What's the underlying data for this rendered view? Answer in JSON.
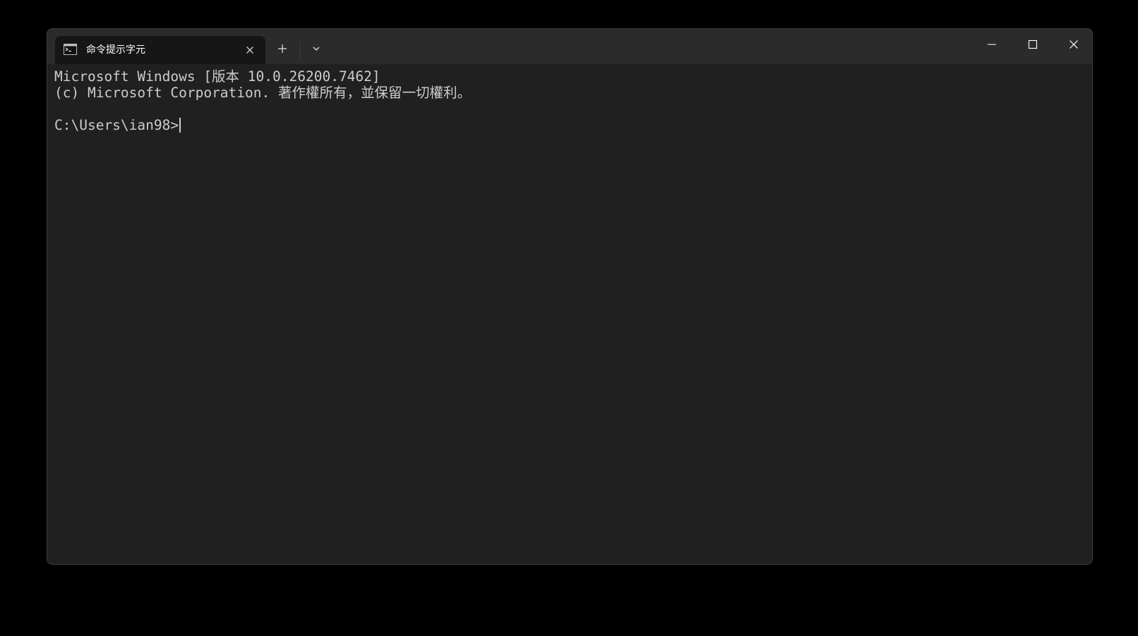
{
  "tab": {
    "title": "命令提示字元",
    "icon": "cmd-console-icon"
  },
  "tabbar": {
    "new_tab_icon": "plus-icon",
    "dropdown_icon": "chevron-down-icon"
  },
  "caption_buttons": {
    "minimize_icon": "minimize-icon",
    "maximize_icon": "maximize-icon",
    "close_icon": "close-icon"
  },
  "terminal": {
    "lines": [
      "Microsoft Windows [版本 10.0.26200.7462]",
      "(c) Microsoft Corporation. 著作權所有，並保留一切權利。",
      ""
    ],
    "prompt": "C:\\Users\\ian98>"
  },
  "colors": {
    "background": "#202020",
    "titlebar": "#2b2b2b",
    "active_tab": "#161616",
    "text": "#cccccc"
  }
}
